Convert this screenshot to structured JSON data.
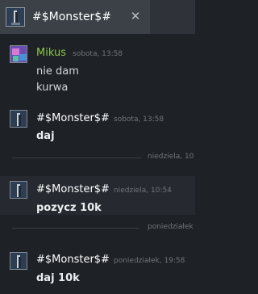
{
  "tab": {
    "title": "#$Monster$#",
    "close_glyph": "✕",
    "avatar_icon": "user-avatar-icon"
  },
  "messages": [
    {
      "author": "Mikus",
      "time": "sobota, 13:58",
      "lines": [
        "nie dam",
        "kurwa"
      ],
      "author_color": "#8bc34a"
    },
    {
      "author": "#$Monster$#",
      "time": "sobota, 13:58",
      "lines": [
        "daj"
      ]
    },
    {
      "author": "#$Monster$#",
      "time": "niedziela, 10:54",
      "lines": [
        "pozycz 10k"
      ]
    },
    {
      "author": "#$Monster$#",
      "time": "poniedziałek, 19:58",
      "lines": [
        "daj 10k"
      ]
    }
  ],
  "date_dividers": [
    "niedziela, 10",
    "poniedziałek"
  ]
}
